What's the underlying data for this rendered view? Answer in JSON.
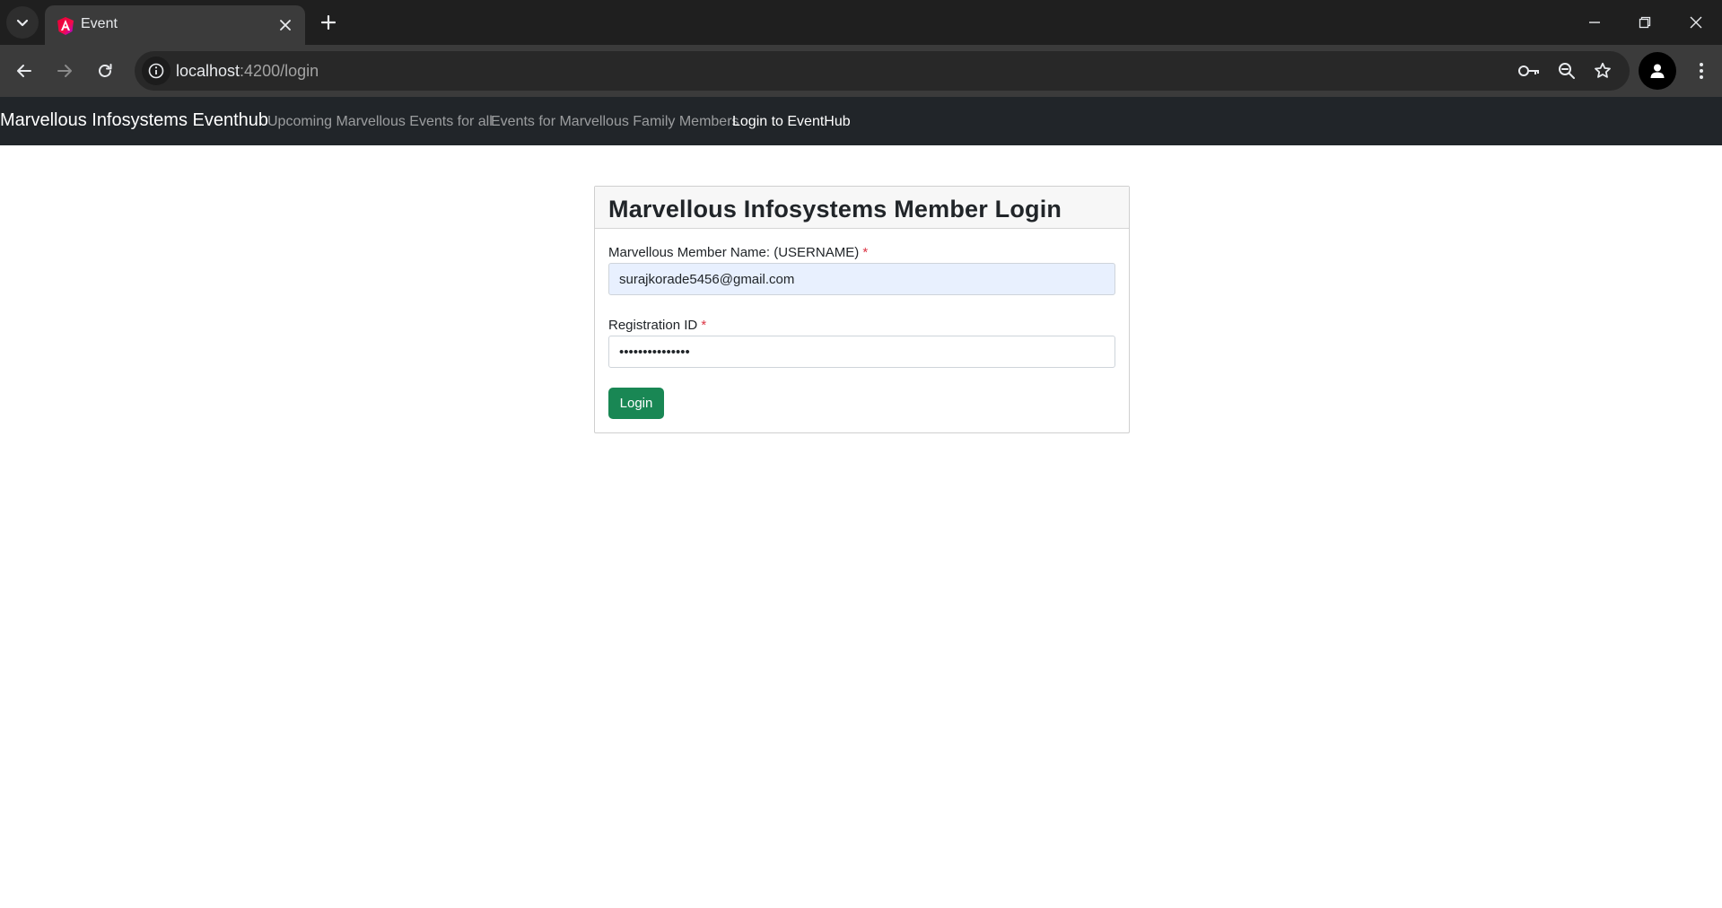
{
  "browser": {
    "tab": {
      "title": "Event"
    },
    "url": {
      "host": "localhost",
      "path": ":4200/login"
    },
    "icons": {
      "tab_search": "chevron-down-icon",
      "favicon": "angular-logo-icon",
      "tab_close": "close-icon",
      "new_tab": "plus-icon",
      "minimize": "minimize-icon",
      "restore": "restore-icon",
      "close_window": "close-icon",
      "back": "arrow-left-icon",
      "forward": "arrow-right-icon",
      "reload": "reload-icon",
      "site_info": "info-icon",
      "passwords": "key-icon",
      "zoom": "zoom-out-icon",
      "bookmark": "star-icon",
      "profile": "person-icon",
      "menu": "kebab-menu-icon"
    }
  },
  "navbar": {
    "brand": "Marvellous Infosystems Eventhub",
    "links": [
      {
        "label": "Upcoming Marvellous Events for all",
        "active": false
      },
      {
        "label": "Events for Marvellous Family Members",
        "active": false
      },
      {
        "label": "Login to EventHub",
        "active": true
      }
    ]
  },
  "login_card": {
    "title": "Marvellous Infosystems Member Login",
    "username": {
      "label": "Marvellous Member Name: (USERNAME)",
      "required_mark": "*",
      "value": "surajkorade5456@gmail.com"
    },
    "registration": {
      "label": "Registration ID",
      "required_mark": "*",
      "value": "•••••••••••••••"
    },
    "submit_label": "Login"
  },
  "colors": {
    "navbar_bg": "#212529",
    "button_green": "#198754",
    "required_red": "#dc3545",
    "autofill_bg": "#e8f0fe"
  }
}
